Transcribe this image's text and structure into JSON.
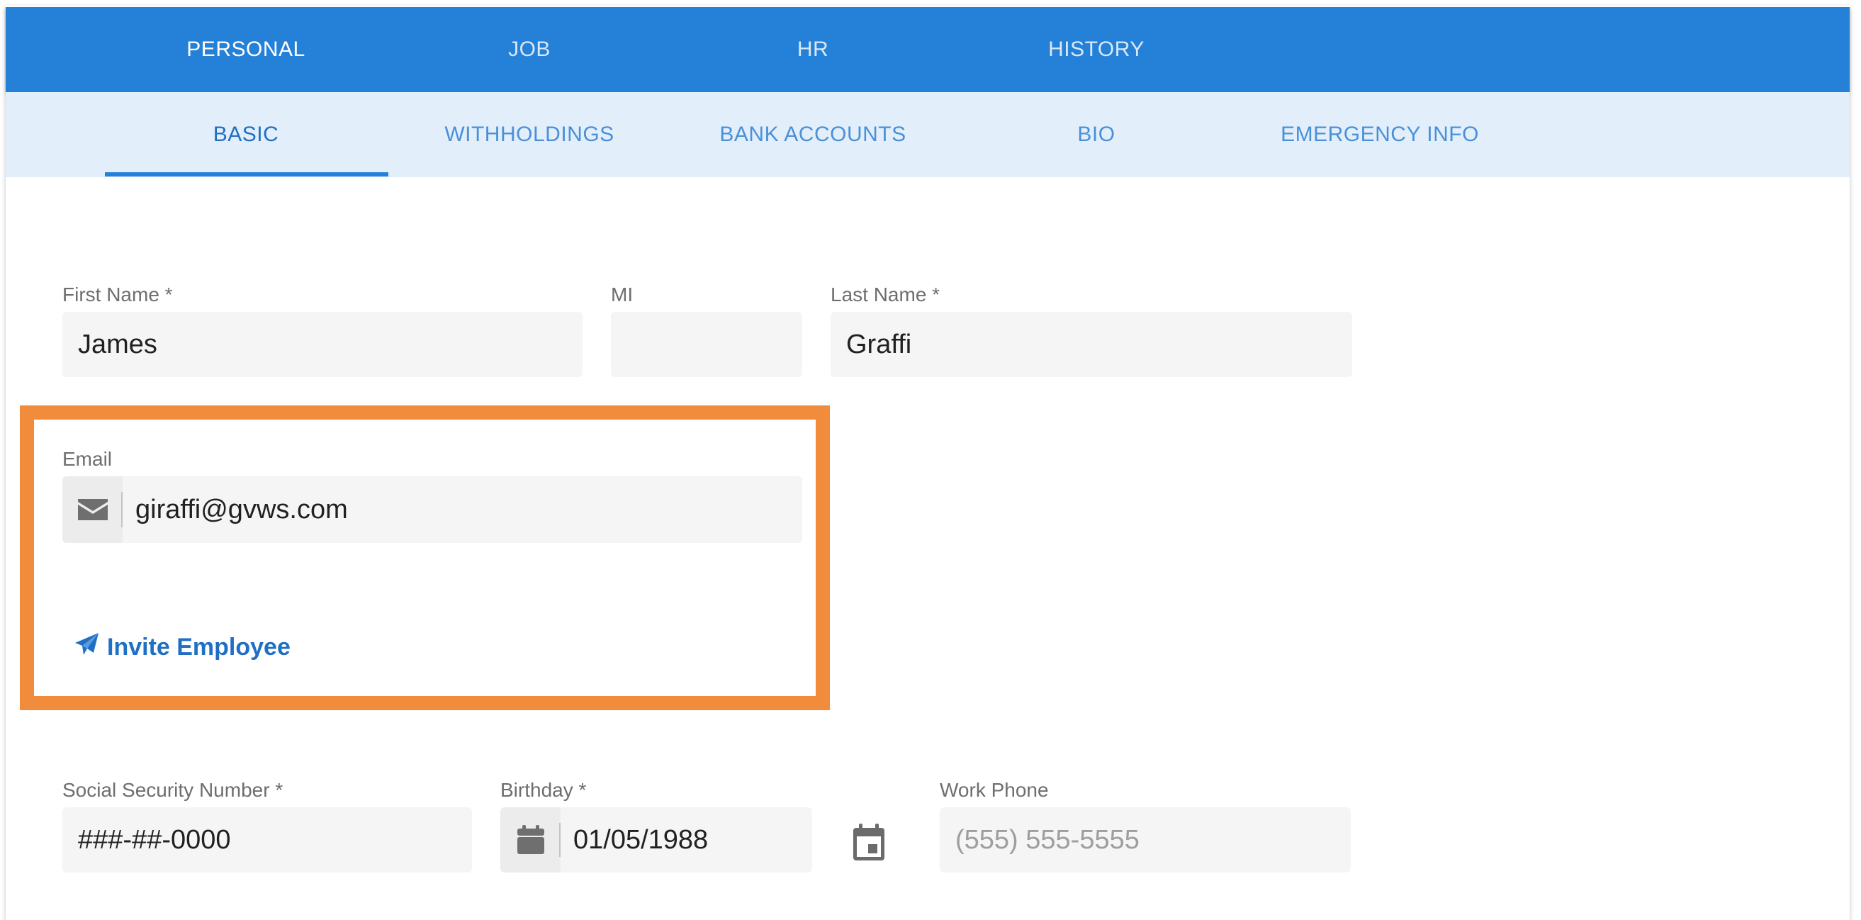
{
  "top_tabs": [
    {
      "label": "PERSONAL"
    },
    {
      "label": "JOB"
    },
    {
      "label": "HR"
    },
    {
      "label": "HISTORY"
    }
  ],
  "sub_tabs": [
    {
      "label": "BASIC"
    },
    {
      "label": "WITHHOLDINGS"
    },
    {
      "label": "BANK ACCOUNTS"
    },
    {
      "label": "BIO"
    },
    {
      "label": "EMERGENCY INFO"
    }
  ],
  "form": {
    "first_name": {
      "label": "First Name *",
      "value": "James"
    },
    "mi": {
      "label": "MI",
      "value": ""
    },
    "last_name": {
      "label": "Last Name *",
      "value": "Graffi"
    },
    "email": {
      "label": "Email",
      "value": "giraffi@gvws.com",
      "icon": "envelope-icon"
    },
    "invite": {
      "label": "Invite Employee",
      "icon": "paper-plane-icon"
    },
    "ssn": {
      "label": "Social Security Number *",
      "value": "###-##-0000"
    },
    "birthday": {
      "label": "Birthday *",
      "value": "01/05/1988",
      "icon": "calendar-icon",
      "picker_icon": "calendar-event-icon"
    },
    "work_phone": {
      "label": "Work Phone",
      "value": "",
      "placeholder": "(555) 555-5555"
    }
  },
  "colors": {
    "primary": "#2580d8",
    "sub_tab_bg": "#e2effb",
    "highlight": "#f08c3c",
    "link": "#1f6fc5"
  }
}
